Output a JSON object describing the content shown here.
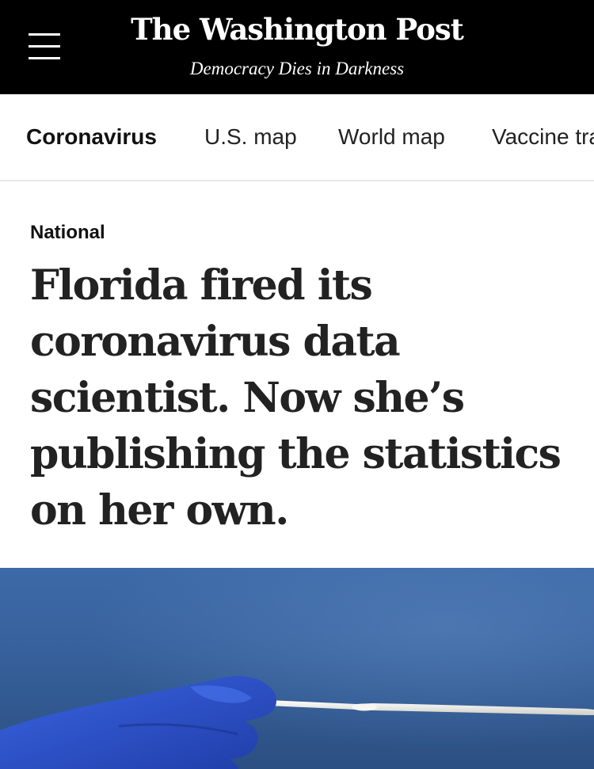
{
  "header": {
    "logo_text": "The Washington Post",
    "tagline": "Democracy Dies in Darkness",
    "menu_icon": "hamburger-menu-icon",
    "background": "#000000"
  },
  "topic_nav": {
    "items": [
      {
        "label": "Coronavirus",
        "active": true
      },
      {
        "label": "U.S. map",
        "active": false
      },
      {
        "label": "World map",
        "active": false
      },
      {
        "label": "Vaccine tracker",
        "active": false
      }
    ]
  },
  "article": {
    "section": "National",
    "headline": "Florida fired its coronavirus data scientist. Now she’s publishing the statistics on her own.",
    "hero_image": {
      "depicts": "gloved-hand-holding-test-swab",
      "colors": {
        "background": "#3a5f9a",
        "glove": "#2d4fc4",
        "swab": "#f2f2ee"
      }
    }
  }
}
